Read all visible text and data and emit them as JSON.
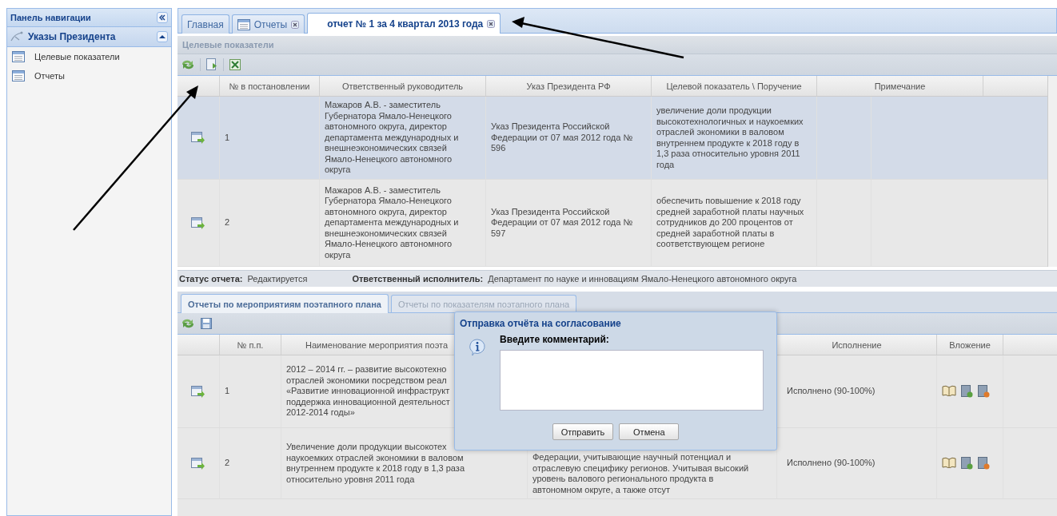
{
  "nav": {
    "title": "Панель навигации",
    "section": {
      "title": "Указы Президента",
      "expanded": true
    },
    "items": [
      {
        "label": "Целевые показатели"
      },
      {
        "label": "Отчеты"
      }
    ]
  },
  "tabs": [
    {
      "label": "Главная",
      "selected": false,
      "closable": false,
      "icon": false
    },
    {
      "label": "Отчеты",
      "selected": false,
      "closable": true,
      "icon": true
    },
    {
      "label": "отчет № 1 за 4 квартал 2013 года",
      "selected": true,
      "closable": true,
      "icon": false
    }
  ],
  "panel": {
    "title": "Целевые показатели",
    "columns": [
      "№ в постановлении",
      "Ответственный руководитель",
      "Указ Президента РФ",
      "Целевой показатель \\ Поручение",
      "Примечание"
    ],
    "rows": [
      {
        "selected": true,
        "cells": [
          [
            "1"
          ],
          [
            "Мажаров А.В. - заместитель",
            "Губернатора Ямало-Ненецкого",
            "автономного округа, директор",
            "департамента международных и",
            "внешнеэкономических связей",
            "Ямало-Ненецкого автономного",
            "округа"
          ],
          [
            "Указ Президента Российской",
            "Федерации от 07 мая 2012 года №",
            "596"
          ],
          [
            "увеличение доли продукции",
            "высокотехнологичных и наукоемких",
            "отраслей экономики в валовом",
            "внутреннем продукте к 2018 году в",
            "1,3 раза относительно уровня 2011",
            "года"
          ]
        ]
      },
      {
        "selected": false,
        "cells": [
          [
            "2"
          ],
          [
            "Мажаров А.В. - заместитель",
            "Губернатора Ямало-Ненецкого",
            "автономного округа, директор",
            "департамента международных и",
            "внешнеэкономических связей",
            "Ямало-Ненецкого автономного",
            "округа"
          ],
          [
            "Указ Президента Российской",
            "Федерации от 07 мая 2012 года №",
            "597"
          ],
          [
            "обеспечить повышение к 2018 году",
            "средней заработной платы научных",
            "сотрудников до 200 процентов от",
            "средней заработной платы в",
            "соответствующем регионе"
          ]
        ]
      }
    ]
  },
  "status": [
    {
      "label": "Статус отчета:",
      "value": "Редактируется"
    },
    {
      "label": "Ответственный исполнитель:",
      "value": "Департамент по науке и инновациям Ямало-Ненецкого автономного округа"
    }
  ],
  "subtabs": [
    {
      "label": "Отчеты по мероприятиям поэтапного плана",
      "selected": true
    },
    {
      "label": "Отчеты по показателям поэтапного плана",
      "selected": false
    }
  ],
  "lower": {
    "columns": [
      {
        "label": "№ п.п."
      },
      {
        "label": "Наименование мероприятия поэта"
      },
      {},
      {
        "label": "Исполнение"
      },
      {
        "label": "Вложение"
      }
    ],
    "rows": [
      {
        "cells": [
          {
            "lines": [
              "1"
            ]
          },
          {
            "lines": [
              "2012 – 2014 гг. – развитие высокотехно",
              "отраслей экономики посредством реал",
              "«Развитие инновационной инфраструкт",
              "поддержка инновационной деятельност",
              "2012-2014 годы»"
            ]
          },
          {},
          {
            "lines": [
              "Исполнено (90-100%)"
            ]
          }
        ]
      },
      {
        "cells": [
          {
            "lines": [
              "2"
            ]
          },
          {
            "lines": [
              "Увеличение доли продукции высокотех",
              "наукоемких отраслей экономики в валовом",
              "внутреннем продукте к 2018 году в 1,3 раза",
              "относительно уровня 2011 года"
            ]
          },
          {
            "lines": [
              "Федерации, учитывающие научный потенциал и",
              "отраслевую специфику регионов. Учитывая высокий",
              "уровень валового регионального продукта в",
              "автономном округе, а также отсут"
            ]
          },
          {
            "lines": [
              "Исполнено (90-100%)"
            ]
          }
        ]
      }
    ]
  },
  "dialog": {
    "title": "Отправка отчёта на согласование",
    "label": "Введите комментарий:",
    "buttons": [
      "Отправить",
      "Отмена"
    ]
  }
}
